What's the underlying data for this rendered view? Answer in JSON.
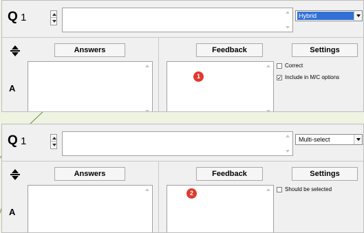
{
  "panels": [
    {
      "question_letter": "Q",
      "question_number": "1",
      "question_type": "Hybrid",
      "buttons": {
        "answers": "Answers",
        "feedback": "Feedback",
        "settings": "Settings"
      },
      "answer_letter": "A",
      "checkboxes": [
        {
          "label": "Correct",
          "checked": false,
          "mark": ""
        },
        {
          "label": "Include in M/C options",
          "checked": true,
          "mark": "✓"
        }
      ],
      "badge": "1"
    },
    {
      "question_letter": "Q",
      "question_number": "1",
      "question_type": "Multi-select",
      "buttons": {
        "answers": "Answers",
        "feedback": "Feedback",
        "settings": "Settings"
      },
      "answer_letter": "A",
      "checkboxes": [
        {
          "label": "Should be selected",
          "checked": false,
          "mark": ""
        }
      ],
      "badge": "2"
    }
  ],
  "colors": {
    "badge": "#e03a2e",
    "selection": "#3370d6",
    "background": "#eef3e2"
  }
}
